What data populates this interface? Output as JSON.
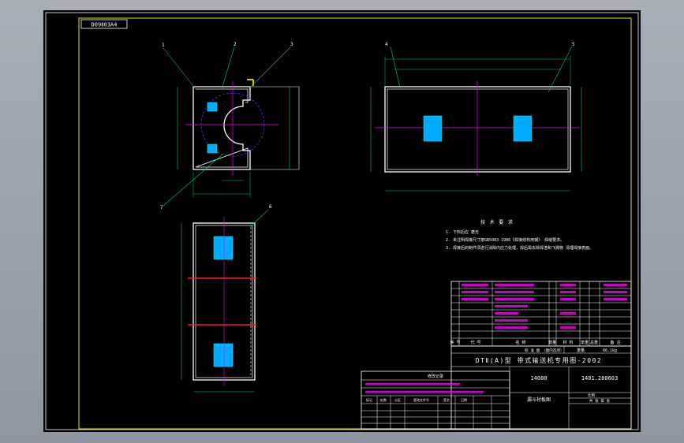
{
  "drawing_no": "D09Ⅱ03A4",
  "balloons": [
    "1",
    "2",
    "3",
    "4",
    "5",
    "6",
    "7"
  ],
  "notes": {
    "title": "技 术 要 求",
    "items": [
      "1. 下料后应 磨光",
      "2. 未注明焊接尺寸按GB5083-1986《焊接结构用钢》 焊缝要求。",
      "3. 焊接后的制件须进行消除内应力处理，焊后需去除焊渣和飞溅物 清理焊接表面。"
    ]
  },
  "title_block": {
    "standard_line": "DTⅡ(A)型 带式输送机专用图-2002",
    "code": "14080",
    "part_name": "漏斗衬板图",
    "drawing_code": "1401.280603",
    "scale_label": "比例",
    "weight_label": "重量",
    "weight": "66.1kg",
    "sheet_label": "共 张 第 张"
  },
  "parts_list_headers": [
    "序 号",
    "代 号",
    "名 称",
    "数量",
    "材 料",
    "单重",
    "总重",
    "备 注"
  ],
  "revision_block": {
    "title": "修改记录",
    "headers": [
      "标记",
      "处数",
      "分区",
      "更改文件号",
      "签名",
      "日期"
    ]
  }
}
